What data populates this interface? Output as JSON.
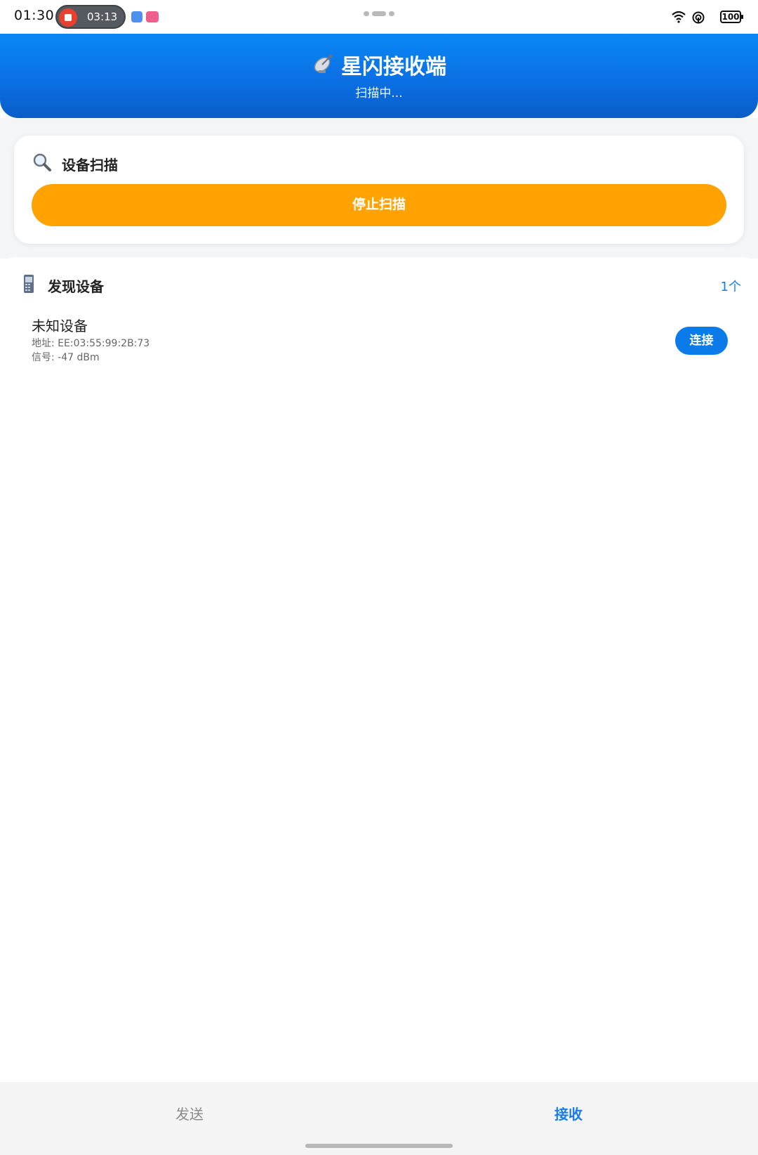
{
  "status_bar": {
    "time": "01:30",
    "recording_time": "03:13",
    "battery": "100",
    "icons": [
      "record-stop-icon",
      "fingerprint-app-icon",
      "music-app-icon",
      "wifi-icon",
      "nfc-icon",
      "battery-icon"
    ]
  },
  "header": {
    "icon": "satellite-antenna-icon",
    "title": "星闪接收端",
    "subtitle": "扫描中..."
  },
  "scan_card": {
    "icon": "magnifier-icon",
    "title": "设备扫描",
    "stop_button": "停止扫描"
  },
  "devices": {
    "icon": "phone-icon",
    "title": "发现设备",
    "count": "1个",
    "items": [
      {
        "name": "未知设备",
        "address": "地址: EE:03:55:99:2B:73",
        "signal": "信号: -47 dBm",
        "action": "连接"
      }
    ]
  },
  "tabs": {
    "send": "发送",
    "receive": "接收",
    "active": "receive"
  },
  "colors": {
    "header_blue": "#0a6ee2",
    "stop_orange": "#ffa202",
    "accent_blue": "#1a7de6"
  }
}
